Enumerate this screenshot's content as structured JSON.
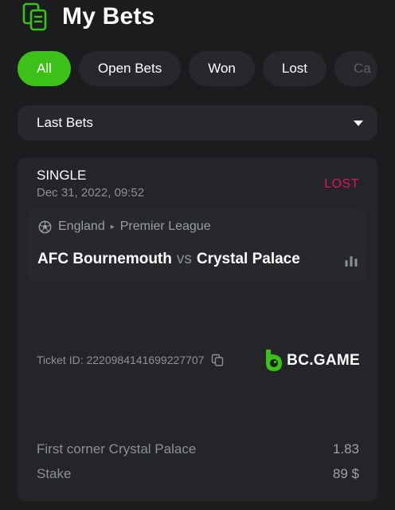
{
  "header": {
    "title": "My Bets",
    "icon": "bet-slip-icon"
  },
  "tabs": [
    {
      "label": "All",
      "active": true
    },
    {
      "label": "Open Bets",
      "active": false
    },
    {
      "label": "Won",
      "active": false
    },
    {
      "label": "Lost",
      "active": false
    },
    {
      "label": "Ca",
      "active": false
    }
  ],
  "filter": {
    "selected": "Last Bets",
    "icon": "caret-down-icon"
  },
  "bet": {
    "type": "SINGLE",
    "date": "Dec 31, 2022, 09:52",
    "status": "LOST",
    "country": "England",
    "league": "Premier League",
    "home_team": "AFC Bournemouth",
    "vs": "vs",
    "away_team": "Crystal Palace",
    "ticket_id": "Ticket ID: 2220984141699227707",
    "brand": "BC.GAME",
    "selection_label": "First corner Crystal Palace",
    "odds": "1.83",
    "stake_label": "Stake",
    "stake_value": "89 $"
  },
  "colors": {
    "accent_green": "#3bc117",
    "status_lost": "#e0125f",
    "background": "#1a1c1e",
    "card": "#232528"
  }
}
